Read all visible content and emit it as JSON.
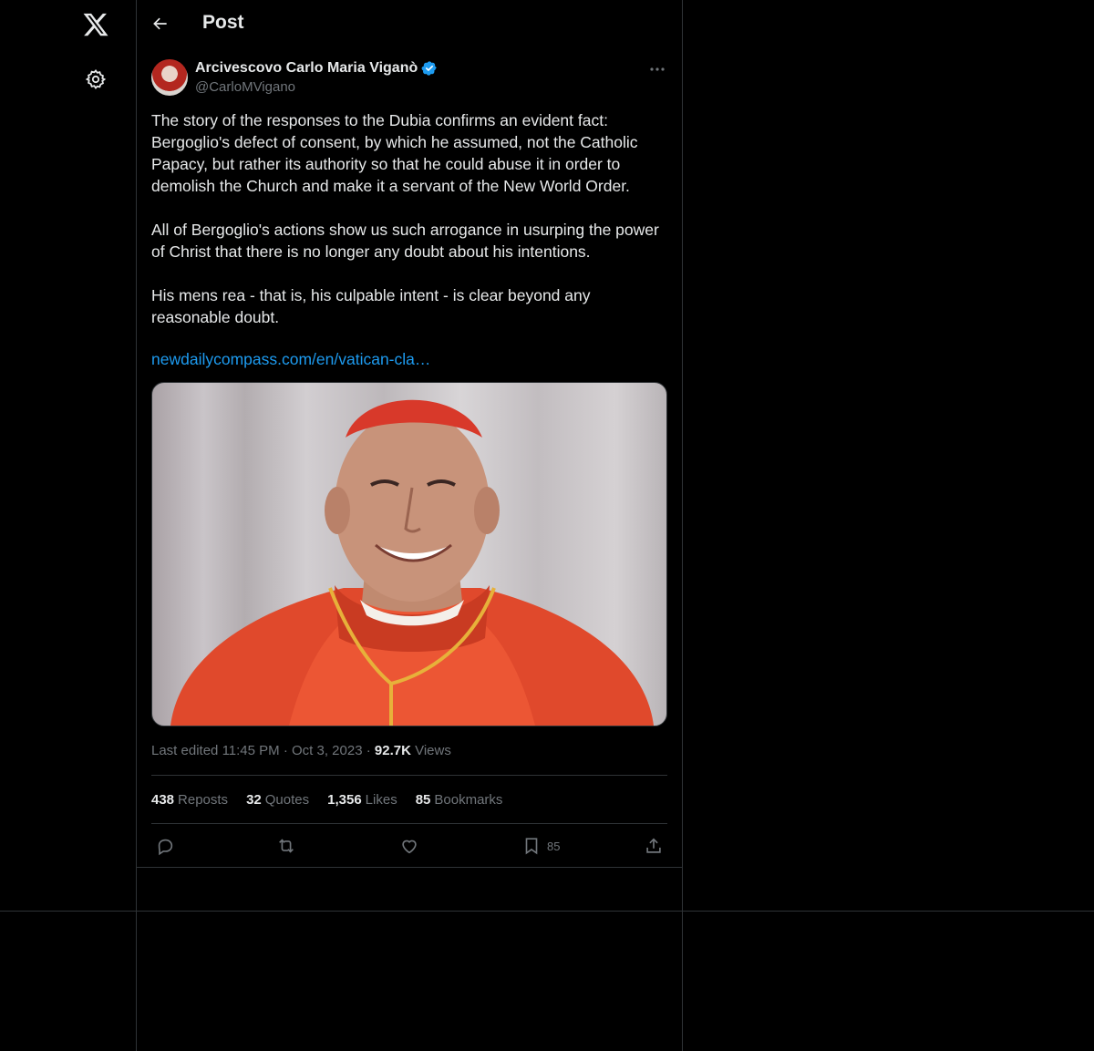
{
  "nav": {
    "logo_icon": "x-logo-icon",
    "settings_icon": "gear-icon"
  },
  "header": {
    "back_icon": "arrow-left-icon",
    "title": "Post"
  },
  "post": {
    "author_name": "Arcivescovo Carlo Maria Viganò",
    "handle": "@CarloMVigano",
    "verified_color": "#1d9bf0",
    "text": "The story of the responses to the Dubia confirms an evident fact: Bergoglio's defect of consent, by which he assumed, not the Catholic Papacy, but rather its authority so that he could abuse it in order to demolish the Church and make it a servant of the New World Order.\n\nAll of Bergoglio's actions show us such arrogance in usurping the power of Christ that there is no longer any doubt about his intentions.\n\nHis mens rea - that is, his culpable intent - is clear beyond any reasonable doubt.",
    "link": "newdailycompass.com/en/vatican-cla…",
    "meta": {
      "edited_label": "Last edited",
      "time": "11:45 PM",
      "date": "Oct 3, 2023",
      "views_count": "92.7K",
      "views_label": "Views"
    },
    "stats": {
      "reposts_count": "438",
      "reposts_label": "Reposts",
      "quotes_count": "32",
      "quotes_label": "Quotes",
      "likes_count": "1,356",
      "likes_label": "Likes",
      "bookmarks_count": "85",
      "bookmarks_label": "Bookmarks"
    },
    "actions": {
      "bookmark_count": "85"
    }
  },
  "colors": {
    "background": "#000000",
    "text": "#e7e9ea",
    "secondary": "#71767b",
    "link": "#1d9bf0",
    "border": "#2f3336"
  }
}
